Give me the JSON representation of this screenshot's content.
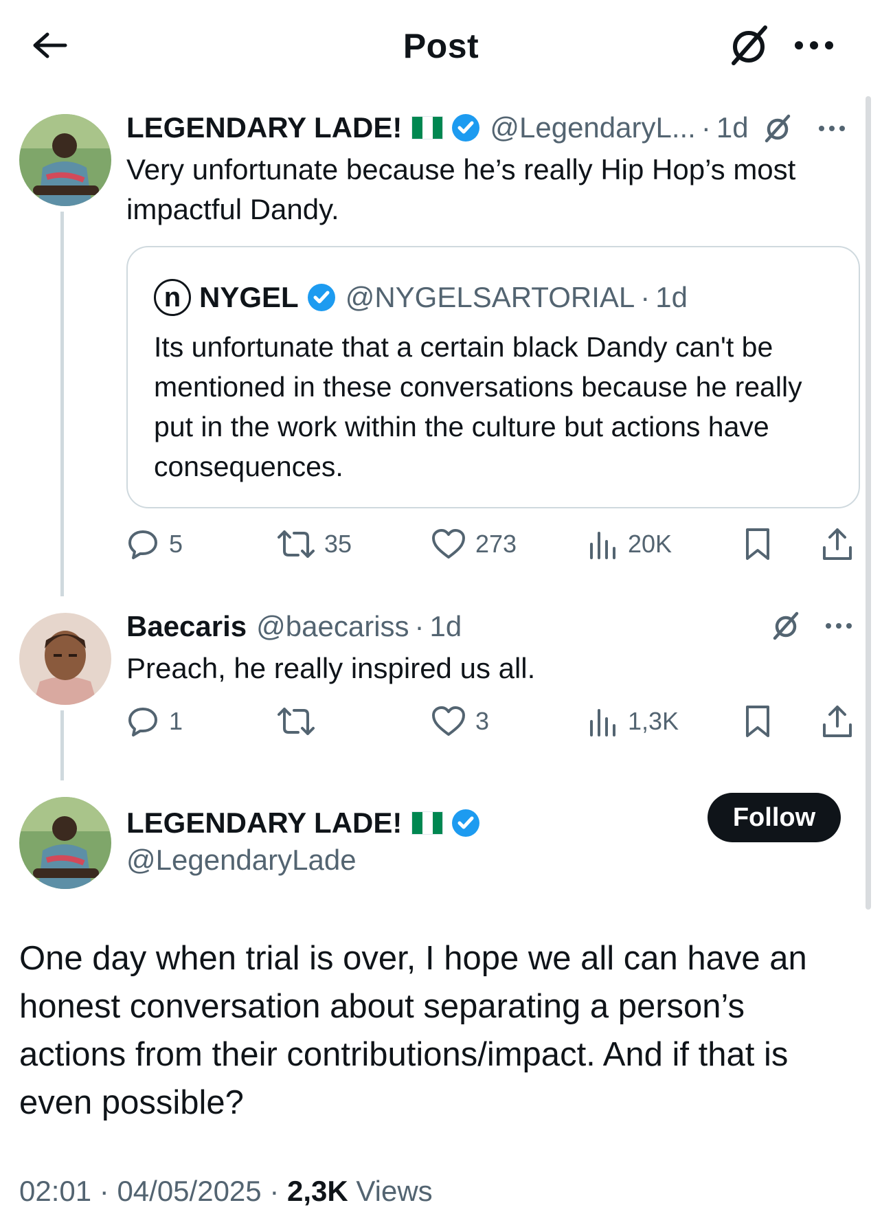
{
  "header": {
    "title": "Post"
  },
  "tweet1": {
    "name": "LEGENDARY LADE!",
    "handle": "@LegendaryL...",
    "time": "1d",
    "text": "Very unfortunate because he’s really Hip Hop’s most impactful Dandy.",
    "quote": {
      "avatar_letter": "n",
      "name": "NYGEL",
      "handle": "@NYGELSARTORIAL",
      "time": "1d",
      "text": "Its unfortunate that a certain black Dandy can't be mentioned in these conversations because he really put in the work within the culture but actions have consequences."
    },
    "stats": {
      "replies": "5",
      "reposts": "35",
      "likes": "273",
      "views": "20K"
    }
  },
  "tweet2": {
    "name": "Baecaris",
    "handle": "@baecariss",
    "time": "1d",
    "text": "Preach, he really inspired us all.",
    "stats": {
      "replies": "1",
      "reposts": "",
      "likes": "3",
      "views": "1,3K"
    }
  },
  "main": {
    "name": "LEGENDARY LADE!",
    "handle": "@LegendaryLade",
    "follow_label": "Follow",
    "text": "One day when trial is over, I hope we all  can have an honest conversation about separating a person’s actions from their contributions/impact. And if that is even possible?",
    "time": "02:01",
    "date": "04/05/2025",
    "views_count": "2,3K",
    "views_label": "Views"
  },
  "colors": {
    "text": "#0f1419",
    "secondary": "#536471",
    "verified": "#1d9bf0",
    "border": "#cfd9de",
    "flag_green": "#008751"
  }
}
